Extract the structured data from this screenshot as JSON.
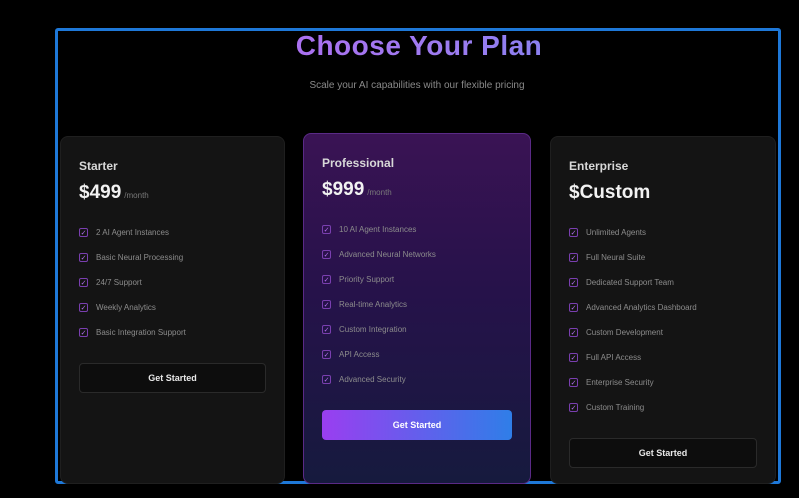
{
  "header": {
    "title": "Choose Your Plan",
    "subtitle": "Scale your AI capabilities with our flexible pricing"
  },
  "colors": {
    "accent_purple": "#9a3ef0",
    "accent_blue": "#2f7ee8",
    "frame_border": "#1e78d8",
    "background": "#000000"
  },
  "plans": [
    {
      "name": "Starter",
      "price": "$499",
      "period": "/month",
      "features": [
        "2 AI Agent Instances",
        "Basic Neural Processing",
        "24/7 Support",
        "Weekly Analytics",
        "Basic Integration Support"
      ],
      "button_label": "Get Started"
    },
    {
      "name": "Professional",
      "price": "$999",
      "period": "/month",
      "features": [
        "10 AI Agent Instances",
        "Advanced Neural Networks",
        "Priority Support",
        "Real-time Analytics",
        "Custom Integration",
        "API Access",
        "Advanced Security"
      ],
      "button_label": "Get Started"
    },
    {
      "name": "Enterprise",
      "price": "$Custom",
      "period": "",
      "features": [
        "Unlimited Agents",
        "Full Neural Suite",
        "Dedicated Support Team",
        "Advanced Analytics Dashboard",
        "Custom Development",
        "Full API Access",
        "Enterprise Security",
        "Custom Training"
      ],
      "button_label": "Get Started"
    }
  ]
}
